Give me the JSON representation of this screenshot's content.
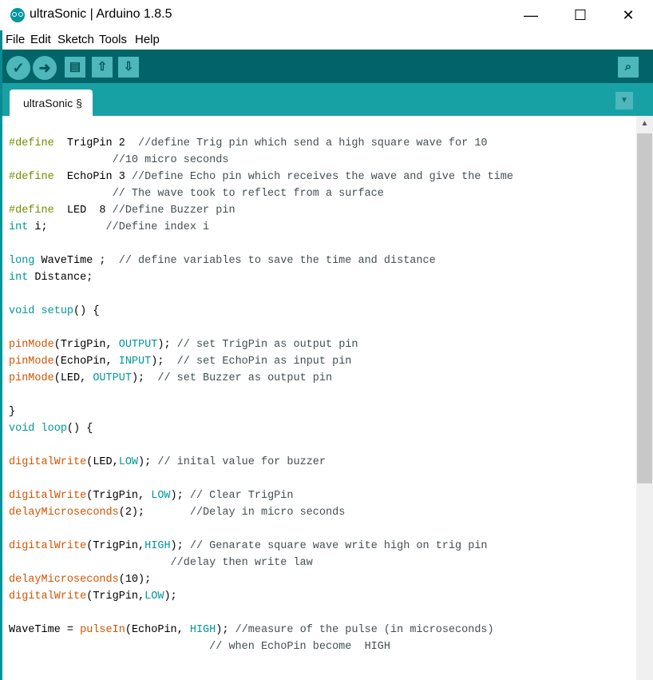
{
  "window": {
    "title": "ultraSonic | Arduino 1.8.5",
    "icon": "arduino-logo-icon",
    "controls": {
      "minimize": "—",
      "maximize": "☐",
      "close": "✕"
    }
  },
  "menu": [
    "File",
    "Edit",
    "Sketch",
    "Tools",
    "Help"
  ],
  "toolbar": {
    "verify": "✓",
    "upload": "➜",
    "new": "▤",
    "open": "⇧",
    "save": "⇩",
    "serial_monitor": "⌕"
  },
  "tab": {
    "label": "ultraSonic §",
    "menu_glyph": "▼"
  },
  "scrollbar": {
    "up_glyph": "▲"
  },
  "colors": {
    "toolbar_bg": "#006468",
    "tabbar_bg": "#17a1a5",
    "button_bg": "#4db7bb",
    "keyword_define": "#728e00",
    "keyword_type": "#00979c",
    "function": "#d35400",
    "comment": "#434f54"
  },
  "code_lines": [
    [
      [
        "kw-d",
        "#define"
      ],
      [
        "",
        "  TrigPin 2  "
      ],
      [
        "com",
        "//define Trig pin which send a high square wave for 10"
      ]
    ],
    [
      [
        "com",
        "                //10 micro seconds"
      ]
    ],
    [
      [
        "kw-d",
        "#define"
      ],
      [
        "",
        "  EchoPin 3 "
      ],
      [
        "com",
        "//Define Echo pin which receives the wave and give the time"
      ]
    ],
    [
      [
        "com",
        "                // The wave took to reflect from a surface"
      ]
    ],
    [
      [
        "kw-d",
        "#define"
      ],
      [
        "",
        "  LED  8 "
      ],
      [
        "com",
        "//Define Buzzer pin"
      ]
    ],
    [
      [
        "kw-t",
        "int"
      ],
      [
        "",
        " i;         "
      ],
      [
        "com",
        "//Define index i"
      ]
    ],
    [],
    [
      [
        "kw-t",
        "long"
      ],
      [
        "",
        " WaveTime ;  "
      ],
      [
        "com",
        "// define variables to save the time and distance"
      ]
    ],
    [
      [
        "kw-t",
        "int"
      ],
      [
        "",
        " Distance;"
      ]
    ],
    [],
    [
      [
        "kw-t",
        "void"
      ],
      [
        "",
        " "
      ],
      [
        "kw-t",
        "setup"
      ],
      [
        "",
        "() {"
      ]
    ],
    [],
    [
      [
        "fn",
        "pinMode"
      ],
      [
        "",
        "(TrigPin, "
      ],
      [
        "const",
        "OUTPUT"
      ],
      [
        "",
        "); "
      ],
      [
        "com",
        "// set TrigPin as output pin"
      ]
    ],
    [
      [
        "fn",
        "pinMode"
      ],
      [
        "",
        "(EchoPin, "
      ],
      [
        "const",
        "INPUT"
      ],
      [
        "",
        "); "
      ],
      [
        "com",
        " // set EchoPin as input pin"
      ]
    ],
    [
      [
        "fn",
        "pinMode"
      ],
      [
        "",
        "(LED, "
      ],
      [
        "const",
        "OUTPUT"
      ],
      [
        "",
        "); "
      ],
      [
        "com",
        " // set Buzzer as output pin"
      ]
    ],
    [],
    [
      [
        "",
        "}"
      ]
    ],
    [
      [
        "kw-t",
        "void"
      ],
      [
        "",
        " "
      ],
      [
        "kw-t",
        "loop"
      ],
      [
        "",
        "() {"
      ]
    ],
    [],
    [
      [
        "fn",
        "digitalWrite"
      ],
      [
        "",
        "(LED,"
      ],
      [
        "const",
        "LOW"
      ],
      [
        "",
        "); "
      ],
      [
        "com",
        "// inital value for buzzer"
      ]
    ],
    [],
    [
      [
        "fn",
        "digitalWrite"
      ],
      [
        "",
        "(TrigPin, "
      ],
      [
        "const",
        "LOW"
      ],
      [
        "",
        "); "
      ],
      [
        "com",
        "// Clear TrigPin"
      ]
    ],
    [
      [
        "fn",
        "delayMicroseconds"
      ],
      [
        "",
        "(2);       "
      ],
      [
        "com",
        "//Delay in micro seconds"
      ]
    ],
    [],
    [
      [
        "fn",
        "digitalWrite"
      ],
      [
        "",
        "(TrigPin,"
      ],
      [
        "const",
        "HIGH"
      ],
      [
        "",
        "); "
      ],
      [
        "com",
        "// Genarate square wave write high on trig pin"
      ]
    ],
    [
      [
        "com",
        "                         //delay then write law"
      ]
    ],
    [
      [
        "fn",
        "delayMicroseconds"
      ],
      [
        "",
        "(10);"
      ]
    ],
    [
      [
        "fn",
        "digitalWrite"
      ],
      [
        "",
        "(TrigPin,"
      ],
      [
        "const",
        "LOW"
      ],
      [
        "",
        ");"
      ]
    ],
    [],
    [
      [
        "",
        "WaveTime = "
      ],
      [
        "fn",
        "pulseIn"
      ],
      [
        "",
        "(EchoPin, "
      ],
      [
        "const",
        "HIGH"
      ],
      [
        "",
        "); "
      ],
      [
        "com",
        "//measure of the pulse (in microseconds)"
      ]
    ],
    [
      [
        "com",
        "                               // when EchoPin become  HIGH"
      ]
    ]
  ]
}
